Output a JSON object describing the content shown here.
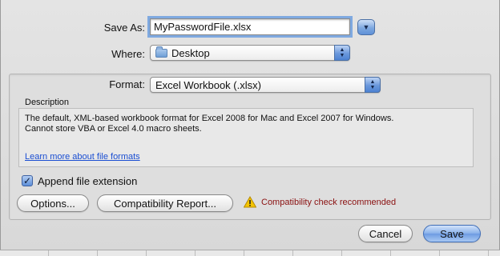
{
  "dialog": {
    "save_as": {
      "label": "Save As:",
      "value": "MyPasswordFile.xlsx"
    },
    "where": {
      "label": "Where:",
      "value": "Desktop",
      "icon": "folder-icon"
    },
    "format": {
      "label": "Format:",
      "value": "Excel Workbook (.xlsx)"
    },
    "description": {
      "heading": "Description",
      "line1": "The default, XML-based workbook format for Excel 2008 for Mac and Excel 2007 for Windows.",
      "line2": "Cannot store VBA or Excel 4.0 macro sheets.",
      "link": "Learn more about file formats"
    },
    "append_extension": {
      "label": "Append file extension",
      "checked": true
    },
    "options_button": "Options...",
    "compatibility_button": "Compatibility Report...",
    "warning": {
      "text": "Compatibility check recommended",
      "icon": "warning-icon"
    },
    "cancel_button": "Cancel",
    "save_button": "Save"
  }
}
